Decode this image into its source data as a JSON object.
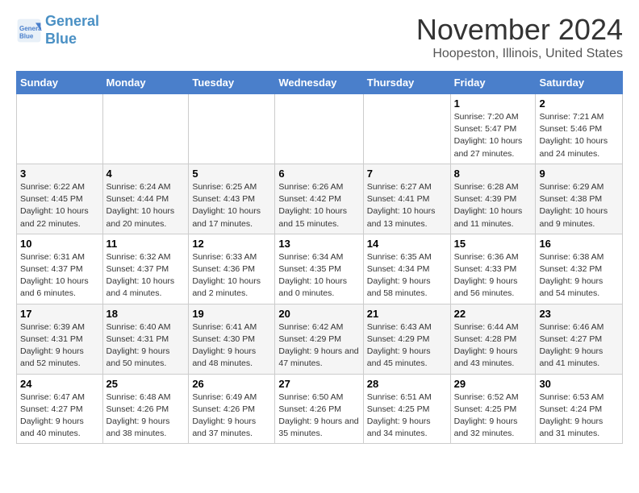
{
  "header": {
    "logo_line1": "General",
    "logo_line2": "Blue",
    "month_title": "November 2024",
    "location": "Hoopeston, Illinois, United States"
  },
  "weekdays": [
    "Sunday",
    "Monday",
    "Tuesday",
    "Wednesday",
    "Thursday",
    "Friday",
    "Saturday"
  ],
  "weeks": [
    [
      {
        "day": "",
        "info": ""
      },
      {
        "day": "",
        "info": ""
      },
      {
        "day": "",
        "info": ""
      },
      {
        "day": "",
        "info": ""
      },
      {
        "day": "",
        "info": ""
      },
      {
        "day": "1",
        "info": "Sunrise: 7:20 AM\nSunset: 5:47 PM\nDaylight: 10 hours and 27 minutes."
      },
      {
        "day": "2",
        "info": "Sunrise: 7:21 AM\nSunset: 5:46 PM\nDaylight: 10 hours and 24 minutes."
      }
    ],
    [
      {
        "day": "3",
        "info": "Sunrise: 6:22 AM\nSunset: 4:45 PM\nDaylight: 10 hours and 22 minutes."
      },
      {
        "day": "4",
        "info": "Sunrise: 6:24 AM\nSunset: 4:44 PM\nDaylight: 10 hours and 20 minutes."
      },
      {
        "day": "5",
        "info": "Sunrise: 6:25 AM\nSunset: 4:43 PM\nDaylight: 10 hours and 17 minutes."
      },
      {
        "day": "6",
        "info": "Sunrise: 6:26 AM\nSunset: 4:42 PM\nDaylight: 10 hours and 15 minutes."
      },
      {
        "day": "7",
        "info": "Sunrise: 6:27 AM\nSunset: 4:41 PM\nDaylight: 10 hours and 13 minutes."
      },
      {
        "day": "8",
        "info": "Sunrise: 6:28 AM\nSunset: 4:39 PM\nDaylight: 10 hours and 11 minutes."
      },
      {
        "day": "9",
        "info": "Sunrise: 6:29 AM\nSunset: 4:38 PM\nDaylight: 10 hours and 9 minutes."
      }
    ],
    [
      {
        "day": "10",
        "info": "Sunrise: 6:31 AM\nSunset: 4:37 PM\nDaylight: 10 hours and 6 minutes."
      },
      {
        "day": "11",
        "info": "Sunrise: 6:32 AM\nSunset: 4:37 PM\nDaylight: 10 hours and 4 minutes."
      },
      {
        "day": "12",
        "info": "Sunrise: 6:33 AM\nSunset: 4:36 PM\nDaylight: 10 hours and 2 minutes."
      },
      {
        "day": "13",
        "info": "Sunrise: 6:34 AM\nSunset: 4:35 PM\nDaylight: 10 hours and 0 minutes."
      },
      {
        "day": "14",
        "info": "Sunrise: 6:35 AM\nSunset: 4:34 PM\nDaylight: 9 hours and 58 minutes."
      },
      {
        "day": "15",
        "info": "Sunrise: 6:36 AM\nSunset: 4:33 PM\nDaylight: 9 hours and 56 minutes."
      },
      {
        "day": "16",
        "info": "Sunrise: 6:38 AM\nSunset: 4:32 PM\nDaylight: 9 hours and 54 minutes."
      }
    ],
    [
      {
        "day": "17",
        "info": "Sunrise: 6:39 AM\nSunset: 4:31 PM\nDaylight: 9 hours and 52 minutes."
      },
      {
        "day": "18",
        "info": "Sunrise: 6:40 AM\nSunset: 4:31 PM\nDaylight: 9 hours and 50 minutes."
      },
      {
        "day": "19",
        "info": "Sunrise: 6:41 AM\nSunset: 4:30 PM\nDaylight: 9 hours and 48 minutes."
      },
      {
        "day": "20",
        "info": "Sunrise: 6:42 AM\nSunset: 4:29 PM\nDaylight: 9 hours and 47 minutes."
      },
      {
        "day": "21",
        "info": "Sunrise: 6:43 AM\nSunset: 4:29 PM\nDaylight: 9 hours and 45 minutes."
      },
      {
        "day": "22",
        "info": "Sunrise: 6:44 AM\nSunset: 4:28 PM\nDaylight: 9 hours and 43 minutes."
      },
      {
        "day": "23",
        "info": "Sunrise: 6:46 AM\nSunset: 4:27 PM\nDaylight: 9 hours and 41 minutes."
      }
    ],
    [
      {
        "day": "24",
        "info": "Sunrise: 6:47 AM\nSunset: 4:27 PM\nDaylight: 9 hours and 40 minutes."
      },
      {
        "day": "25",
        "info": "Sunrise: 6:48 AM\nSunset: 4:26 PM\nDaylight: 9 hours and 38 minutes."
      },
      {
        "day": "26",
        "info": "Sunrise: 6:49 AM\nSunset: 4:26 PM\nDaylight: 9 hours and 37 minutes."
      },
      {
        "day": "27",
        "info": "Sunrise: 6:50 AM\nSunset: 4:26 PM\nDaylight: 9 hours and 35 minutes."
      },
      {
        "day": "28",
        "info": "Sunrise: 6:51 AM\nSunset: 4:25 PM\nDaylight: 9 hours and 34 minutes."
      },
      {
        "day": "29",
        "info": "Sunrise: 6:52 AM\nSunset: 4:25 PM\nDaylight: 9 hours and 32 minutes."
      },
      {
        "day": "30",
        "info": "Sunrise: 6:53 AM\nSunset: 4:24 PM\nDaylight: 9 hours and 31 minutes."
      }
    ]
  ]
}
